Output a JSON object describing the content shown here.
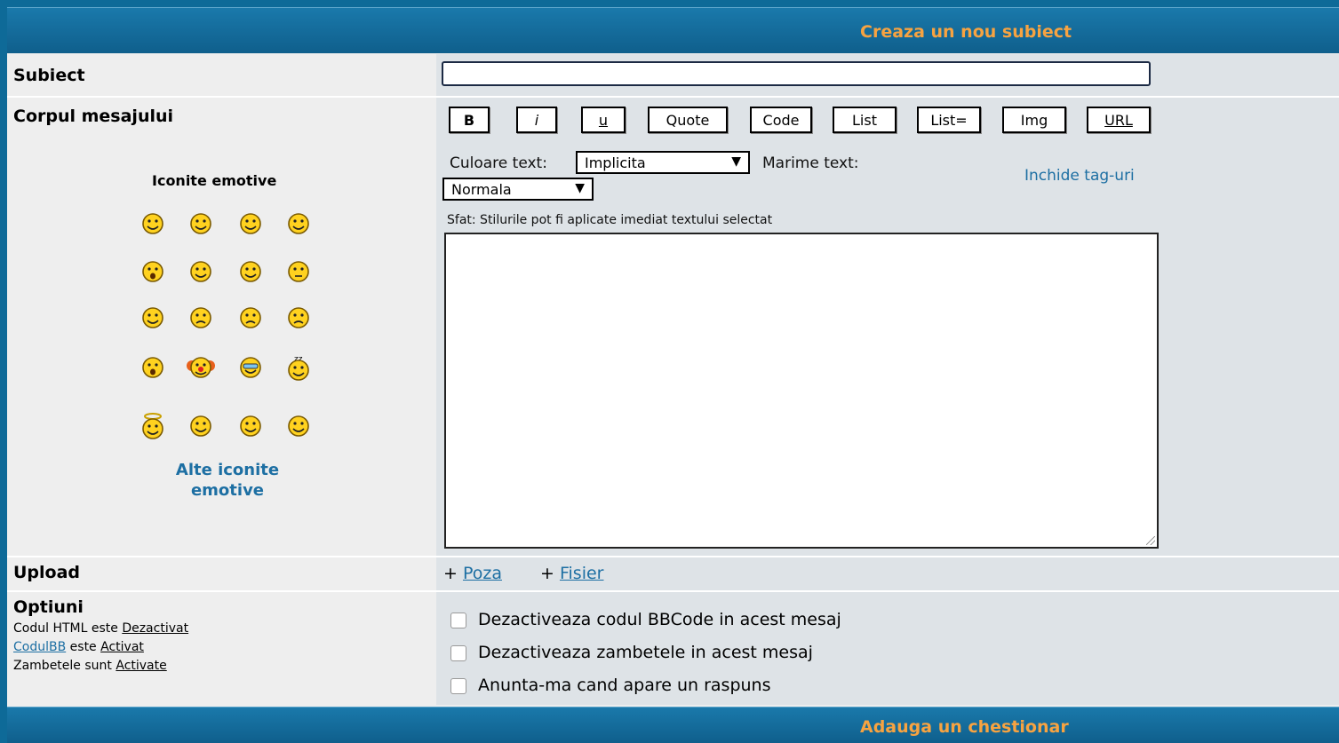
{
  "header": {
    "title": "Creaza un nou subiect"
  },
  "subject": {
    "label": "Subiect",
    "value": ""
  },
  "body": {
    "label": "Corpul mesajului",
    "toolbar": {
      "bold": "B",
      "italic": "i",
      "underline": "u",
      "quote": "Quote",
      "code": "Code",
      "list": "List",
      "list_eq": "List=",
      "img": "Img",
      "url": "URL"
    },
    "color_label": "Culoare text:",
    "color_value": "Implicita",
    "size_label": "Marime text:",
    "size_value": "Normala",
    "close_tags": "Inchide tag-uri",
    "tip": "Sfat: Stilurile pot fi aplicate imediat textului selectat",
    "text": ""
  },
  "emoticons": {
    "title": "Iconite emotive",
    "icons": [
      "smile-icon",
      "grin-icon",
      "happy-icon",
      "laugh-icon",
      "surprised-icon",
      "tongue-icon",
      "wink-icon",
      "neutral-icon",
      "confused-icon",
      "sad-icon",
      "crying-icon",
      "unhappy-icon",
      "shocked-icon",
      "clown-icon",
      "cool-icon",
      "sleep-icon",
      "angel-icon",
      "whistle-icon",
      "rolleyes-icon",
      "blush-icon"
    ],
    "more": "Alte iconite emotive"
  },
  "upload": {
    "label": "Upload",
    "photo_prefix": "+",
    "photo": "Poza",
    "file_prefix": "+",
    "file": "Fisier"
  },
  "options": {
    "label": "Optiuni",
    "html_text": "Codul HTML este",
    "html_state": "Dezactivat",
    "bb_link": "CodulBB",
    "bb_text": "este",
    "bb_state": "Activat",
    "smiley_text": "Zambetele sunt",
    "smiley_state": "Activate",
    "checkboxes": [
      {
        "label": "Dezactiveaza codul BBCode in acest mesaj",
        "checked": false
      },
      {
        "label": "Dezactiveaza zambetele in acest mesaj",
        "checked": false
      },
      {
        "label": "Anunta-ma cand apare un raspuns",
        "checked": false
      }
    ]
  },
  "footer": {
    "title": "Adauga un chestionar"
  },
  "colors": {
    "header_bg": "#0f5f8c",
    "header_text": "#f7a341",
    "link": "#1d6fa3",
    "left_cell": "#eeeeee",
    "right_cell": "#dee3e7"
  }
}
